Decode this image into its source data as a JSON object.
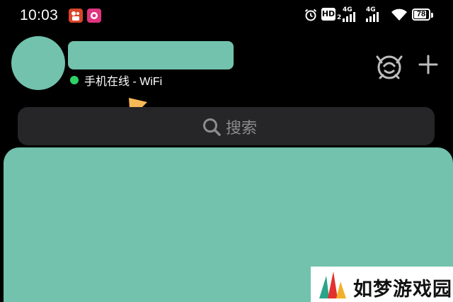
{
  "status_bar": {
    "time": "10:03",
    "icons": [
      "kuaishou-app-icon",
      "pink-app-icon",
      "alarm-icon",
      "hd-icon",
      "cellular-4g-icon",
      "cellular-4g-icon",
      "wifi-icon",
      "battery-icon"
    ],
    "hd_label": "HD",
    "hd_sub": "2",
    "network_1": "4G",
    "network_2": "4G",
    "battery": "78"
  },
  "profile": {
    "presence_status": "手机在线 - WiFi",
    "presence_color": "#2fd266",
    "redaction_color": "#72c2ad"
  },
  "header_actions": {
    "buddy_icon": "buddy-mascot-icon",
    "add_icon": "plus-icon"
  },
  "search": {
    "placeholder": "搜索"
  },
  "annotation": {
    "arrow_color": "#f7b955"
  },
  "watermark": {
    "text": "如梦游戏园"
  }
}
